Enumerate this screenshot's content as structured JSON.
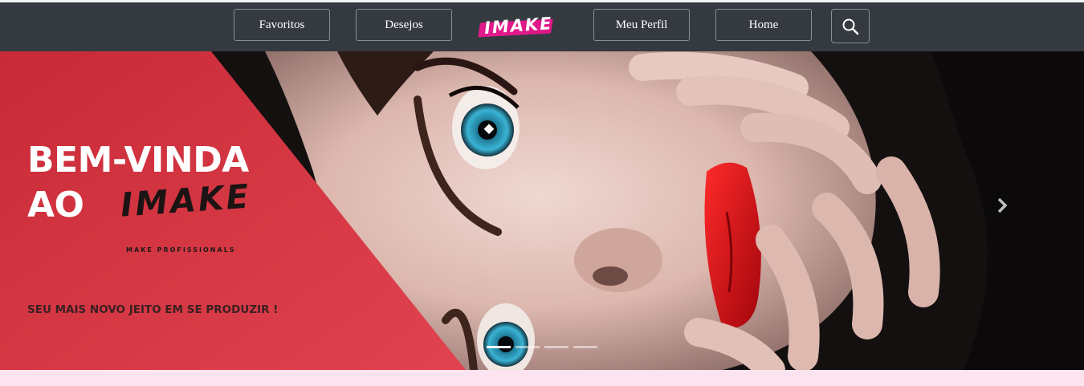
{
  "nav": {
    "items": [
      {
        "label": "Favoritos"
      },
      {
        "label": "Desejos"
      },
      {
        "label": "Meu Perfil"
      },
      {
        "label": "Home"
      }
    ],
    "logo_text": "IMAKE",
    "search_icon": "search-icon",
    "colors": {
      "bar": "#343a40",
      "logo_brush": "#e0198a"
    }
  },
  "hero": {
    "heading_line1": "BEM-VINDA",
    "heading_line2": "AO",
    "brand": "IMAKE",
    "brand_sub": "MAKE PROFISSIONALS",
    "slogan": "SEU MAIS NOVO JEITO EM SE PRODUZIR !",
    "next_icon": "chevron-right-icon",
    "slides": {
      "count": 4,
      "active": 1
    },
    "colors": {
      "overlay": "#c9303d",
      "text": "#ffffff",
      "slogan": "#3a2022"
    }
  }
}
